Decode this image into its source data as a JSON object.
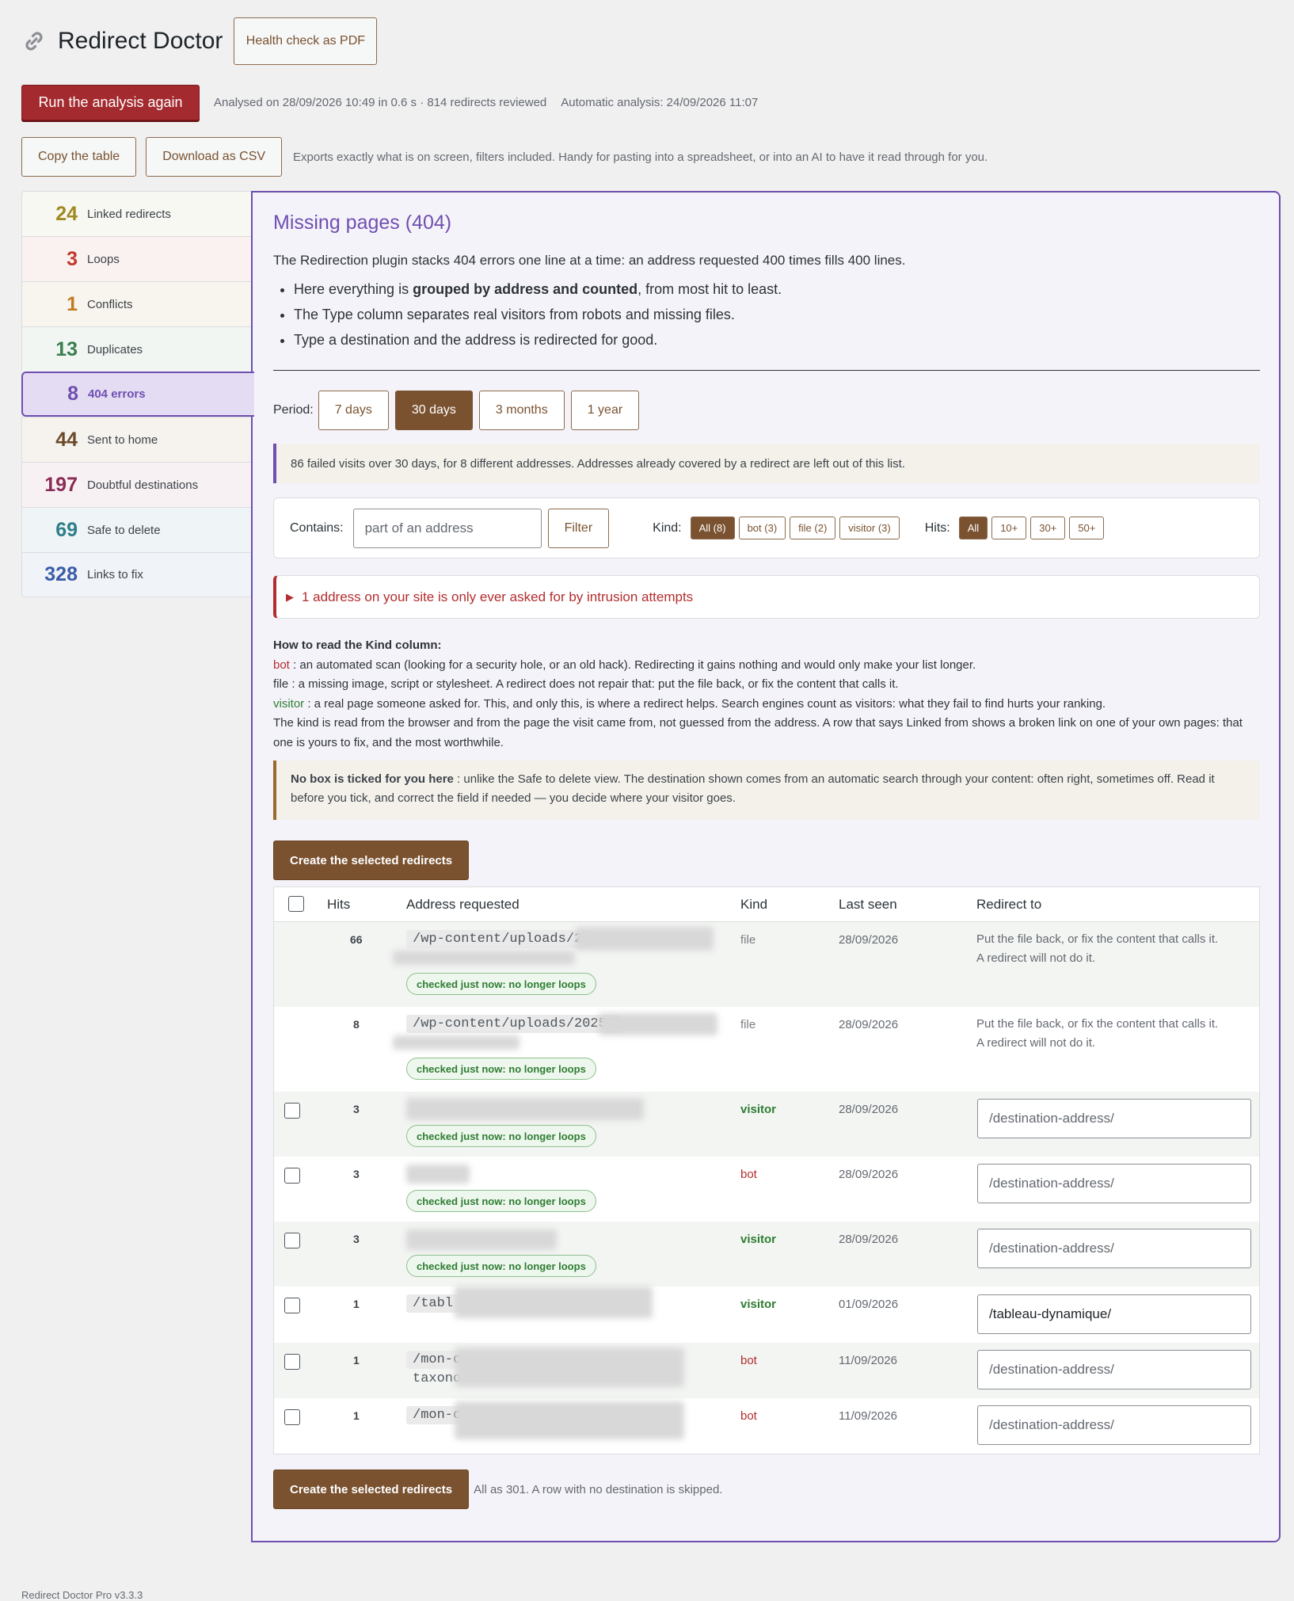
{
  "app": {
    "title": "Redirect Doctor",
    "pdf_button": "Health check as PDF",
    "run_button": "Run the analysis again",
    "analysed": "Analysed on 28/09/2026 10:49 in 0.6 s · 814 redirects reviewed",
    "automatic": "Automatic analysis: 24/09/2026 11:07",
    "copy_button": "Copy the table",
    "csv_button": "Download as CSV",
    "export_note": "Exports exactly what is on screen, filters included. Handy for pasting into a spreadsheet, or into an AI to have it read through for you.",
    "footer": "Redirect Doctor Pro v3.3.3"
  },
  "sidebar": [
    {
      "count": "24",
      "label": "Linked redirects",
      "color": "#a08a20"
    },
    {
      "count": "3",
      "label": "Loops",
      "color": "#c0392b"
    },
    {
      "count": "1",
      "label": "Conflicts",
      "color": "#c07a20"
    },
    {
      "count": "13",
      "label": "Duplicates",
      "color": "#3a7d4e"
    },
    {
      "count": "8",
      "label": "404 errors",
      "color": "#6f4fb0"
    },
    {
      "count": "44",
      "label": "Sent to home",
      "color": "#6b4a2a"
    },
    {
      "count": "197",
      "label": "Doubtful destinations",
      "color": "#8a2a55"
    },
    {
      "count": "69",
      "label": "Safe to delete",
      "color": "#2e7d8a"
    },
    {
      "count": "328",
      "label": "Links to fix",
      "color": "#3a5ca8"
    }
  ],
  "panel": {
    "title": "Missing pages (404)",
    "intro": "The Redirection plugin stacks 404 errors one line at a time: an address requested 400 times fills 400 lines.",
    "bullet1_pre": "Here everything is ",
    "bullet1_bold": "grouped by address and counted",
    "bullet1_post": ", from most hit to least.",
    "bullet2": "The Type column separates real visitors from robots and missing files.",
    "bullet3": "Type a destination and the address is redirected for good.",
    "period_label": "Period:",
    "periods": [
      "7 days",
      "30 days",
      "3 months",
      "1 year"
    ],
    "info": "86 failed visits over 30 days, for 8 different addresses. Addresses already covered by a redirect are left out of this list.",
    "contains_label": "Contains:",
    "contains_placeholder": "part of an address",
    "filter_button": "Filter",
    "kind_label": "Kind:",
    "kinds": [
      "All (8)",
      "bot (3)",
      "file (2)",
      "visitor (3)"
    ],
    "hits_label": "Hits:",
    "hits_filters": [
      "All",
      "10+",
      "30+",
      "50+"
    ],
    "alert": "1 address on your site is only ever asked for by intrusion attempts",
    "howto_head": "How to read the Kind column:",
    "howto_bot_k": "bot",
    "howto_bot": " : an automated scan (looking for a security hole, or an old hack). Redirecting it gains nothing and would only make your list longer.",
    "howto_file": "file : a missing image, script or stylesheet. A redirect does not repair that: put the file back, or fix the content that calls it.",
    "howto_visitor_k": "visitor",
    "howto_visitor": " : a real page someone asked for. This, and only this, is where a redirect helps. Search engines count as visitors: what they fail to find hurts your ranking.",
    "howto_kind": "The kind is read from the browser and from the page the visit came from, not guessed from the address. A row that says Linked from shows a broken link on one of your own pages: that one is yours to fix, and the most worthwhile.",
    "warn_bold": "No box is ticked for you here",
    "warn_text": " : unlike the Safe to delete view. The destination shown comes from an automatic search through your content: often right, sometimes off. Read it before you tick, and correct the field if needed — you decide where your visitor goes.",
    "create_button": "Create the selected redirects",
    "bottom_note": "All as 301. A row with no destination is skipped."
  },
  "table": {
    "headers": [
      "Hits",
      "Address requested",
      "Kind",
      "Last seen",
      "Redirect to"
    ],
    "badge": "checked just now: no longer loops",
    "file_note_1": "Put the file back, or fix the content that calls it.",
    "file_note_2": "A redirect will not do it.",
    "placeholder": "/destination-address/",
    "rows": [
      {
        "hits": "66",
        "addr": "/wp-content/uploads/2",
        "kind": "file",
        "date": "28/09/2026"
      },
      {
        "hits": "8",
        "addr": "/wp-content/uploads/2025/",
        "kind": "file",
        "date": "28/09/2026"
      },
      {
        "hits": "3",
        "addr": "",
        "kind": "visitor",
        "date": "28/09/2026"
      },
      {
        "hits": "3",
        "addr": "",
        "kind": "bot",
        "date": "28/09/2026"
      },
      {
        "hits": "3",
        "addr": "",
        "kind": "visitor",
        "date": "28/09/2026"
      },
      {
        "hits": "1",
        "addr": "/tabl",
        "kind": "visitor",
        "date": "01/09/2026",
        "dest": "/tableau-dynamique/"
      },
      {
        "hits": "1",
        "addr": "/mon-c",
        "addr2": "taxono",
        "kind": "bot",
        "date": "11/09/2026"
      },
      {
        "hits": "1",
        "addr": "/mon-c",
        "kind": "bot",
        "date": "11/09/2026"
      }
    ]
  }
}
